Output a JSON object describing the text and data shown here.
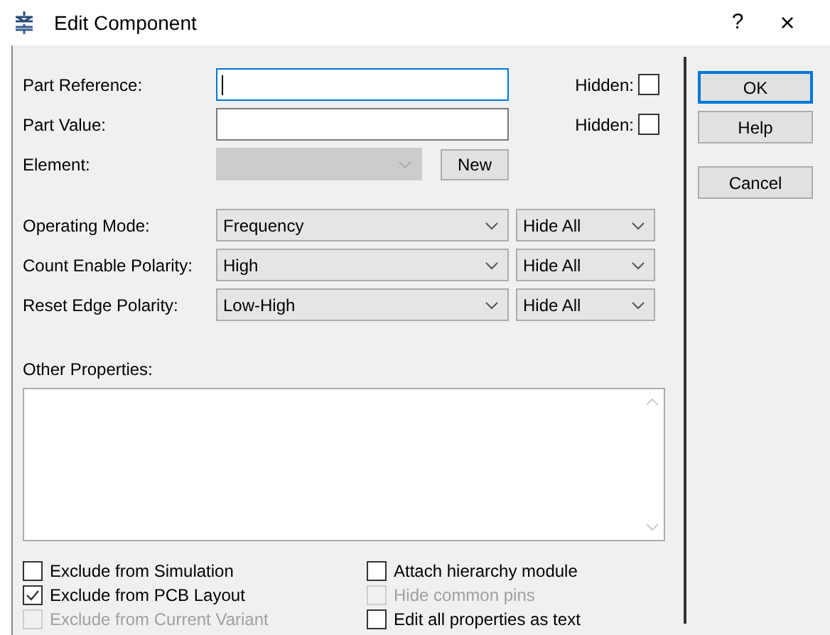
{
  "window": {
    "title": "Edit Component",
    "help_button": "?",
    "close_button": "×"
  },
  "fields": [
    {
      "label": "Part Reference:",
      "focused": true,
      "hidden_label": "Hidden:",
      "hidden": false
    },
    {
      "label": "Part Value:",
      "focused": false,
      "hidden_label": "Hidden:",
      "hidden": false
    }
  ],
  "element": {
    "label": "Element:",
    "disabled": true,
    "new_button": "New"
  },
  "modes": [
    {
      "label": "Operating Mode:",
      "value": "Frequency",
      "visibility": "Hide All"
    },
    {
      "label": "Count Enable Polarity:",
      "value": "High",
      "visibility": "Hide All"
    },
    {
      "label": "Reset Edge Polarity:",
      "value": "Low-High",
      "visibility": "Hide All"
    }
  ],
  "other_properties": {
    "label": "Other Properties:"
  },
  "options_left": [
    {
      "label": "Exclude from Simulation",
      "checked": false,
      "disabled": false
    },
    {
      "label": "Exclude from PCB Layout",
      "checked": true,
      "disabled": false
    },
    {
      "label": "Exclude from Current Variant",
      "checked": false,
      "disabled": true
    }
  ],
  "options_right": [
    {
      "label": "Attach hierarchy module",
      "checked": false,
      "disabled": false
    },
    {
      "label": "Hide common pins",
      "checked": false,
      "disabled": true
    },
    {
      "label": "Edit all properties as text",
      "checked": false,
      "disabled": false
    }
  ],
  "buttons": [
    {
      "label": "OK",
      "default": true
    },
    {
      "label": "Help",
      "default": false
    },
    {
      "label": "Cancel",
      "default": false
    }
  ]
}
